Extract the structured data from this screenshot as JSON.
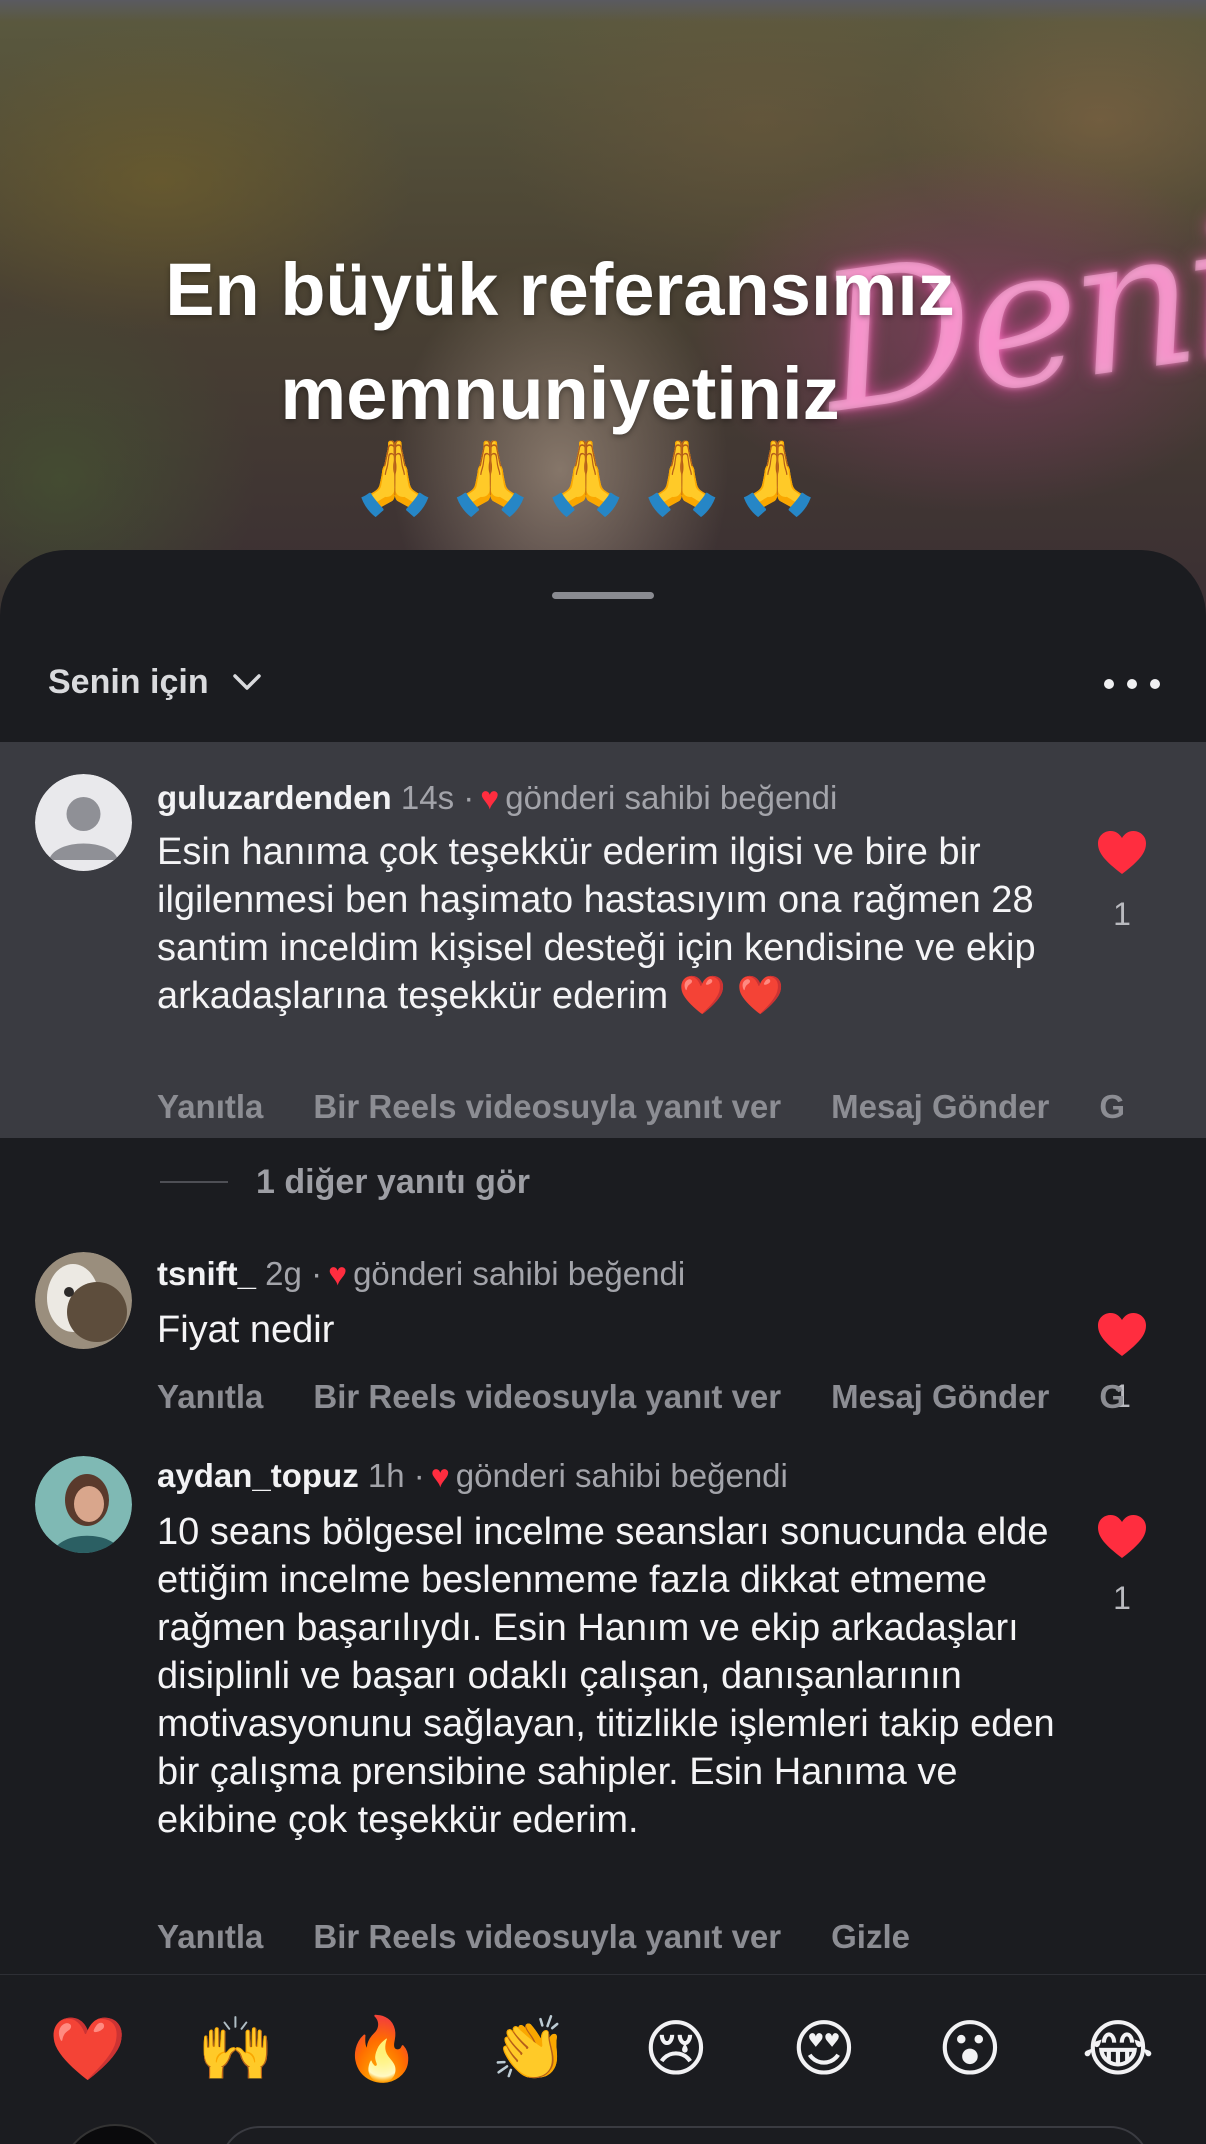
{
  "video": {
    "overlay_line1": "En büyük referansımız",
    "overlay_line2": "memnuniyetiniz",
    "pray_emoji": [
      "🙏",
      "🙏",
      "🙏",
      "🙏",
      "🙏"
    ],
    "neon_sign": "Deniz"
  },
  "sheet": {
    "sort_label": "Senin için"
  },
  "comments": [
    {
      "username": "guluzardenden",
      "time": "14s",
      "liked_by_author": "gönderi sahibi beğendi",
      "text": "Esin hanıma çok teşekkür ederim ilgisi ve bire bir ilgilenmesi  ben haşimato hastasıyım ona rağmen 28 santim inceldim  kişisel desteği için kendisine ve ekip arkadaşlarına teşekkür ederim ❤️ ❤️",
      "like_count": "1",
      "actions": [
        "Yanıtla",
        "Bir Reels videosuyla yanıt ver",
        "Mesaj Gönder",
        "G"
      ]
    },
    {
      "username": "tsnift_",
      "time": "2g",
      "liked_by_author": "gönderi sahibi beğendi",
      "text": "Fiyat nedir",
      "like_count": "1",
      "actions": [
        "Yanıtla",
        "Bir Reels videosuyla yanıt ver",
        "Mesaj Gönder",
        "G"
      ]
    },
    {
      "username": "aydan_topuz",
      "time": "1h",
      "liked_by_author": "gönderi sahibi beğendi",
      "text": "10 seans bölgesel incelme seansları sonucunda elde ettiğim incelme beslenmeme fazla dikkat etmeme rağmen başarılıydı.  Esin Hanım ve ekip arkadaşları disiplinli ve başarı odaklı çalışan, danışanlarının motivasyonunu sağlayan, titizlikle işlemleri takip eden bir çalışma prensibine sahipler.  Esin Hanıma ve ekibine çok teşekkür ederim.",
      "like_count": "1",
      "actions": [
        "Yanıtla",
        "Bir Reels videosuyla yanıt ver",
        "Gizle"
      ]
    }
  ],
  "see_replies": "1 diğer yanıtı gör",
  "reactions": [
    "❤️",
    "🙌",
    "🔥",
    "👏",
    "😢",
    "😍",
    "😮",
    "😂"
  ],
  "colors": {
    "sheet_bg": "#1b1c20",
    "highlight_bg": "#3a3b41",
    "heart": "#ff2d3f",
    "muted_text": "#a3a4aa"
  },
  "icons": [
    "chevron-down-icon",
    "more-dots-icon",
    "heart-icon",
    "default-avatar-icon"
  ]
}
